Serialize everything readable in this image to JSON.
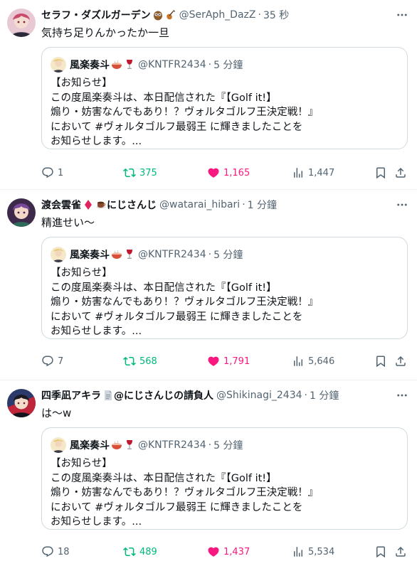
{
  "tweets": [
    {
      "name": "セラフ・ダズルガーデン",
      "handle": "@SerAph_DazZ",
      "time": "35 秒",
      "text": "気持ち足りんかったか一旦",
      "quote": {
        "name": "風楽奏斗",
        "handle": "@KNTFR2434",
        "time": "5 分鐘",
        "lines": [
          "【お知らせ】",
          "この度風楽奏斗は、本日配信された『【Golf it!】",
          "煽り・妨害なんでもあり！？ヴォルタゴルフ王決定戦！』",
          "において #ヴォルタゴルフ最弱王 に輝きましたことを",
          "お知らせします。..."
        ]
      },
      "stats": {
        "replies": "1",
        "retweets": "375",
        "likes": "1,165",
        "views": "1,447"
      }
    },
    {
      "name": "渡会雲雀",
      "suffix": "にじさんじ",
      "handle": "@watarai_hibari",
      "time": "1 分鐘",
      "text": "精進せい〜",
      "quote": {
        "name": "風楽奏斗",
        "handle": "@KNTFR2434",
        "time": "5 分鐘",
        "lines": [
          "【お知らせ】",
          "この度風楽奏斗は、本日配信された『【Golf it!】",
          "煽り・妨害なんでもあり！？ヴォルタゴルフ王決定戦！』",
          "において #ヴォルタゴルフ最弱王 に輝きましたことを",
          "お知らせします。..."
        ]
      },
      "stats": {
        "replies": "7",
        "retweets": "568",
        "likes": "1,791",
        "views": "5,646"
      }
    },
    {
      "name": "四季凪アキラ",
      "suffix": "@にじさんじの請負人",
      "handle": "@Shikinagi_2434",
      "time": "1 分鐘",
      "text": "は〜w",
      "quote": {
        "name": "風楽奏斗",
        "handle": "@KNTFR2434",
        "time": "5 分鐘",
        "lines": [
          "【お知らせ】",
          "この度風楽奏斗は、本日配信された『【Golf it!】",
          "煽り・妨害なんでもあり！？ヴォルタゴルフ王決定戦！』",
          "において #ヴォルタゴルフ最弱王 に輝きましたことを",
          "お知らせします。..."
        ]
      },
      "stats": {
        "replies": "18",
        "retweets": "489",
        "likes": "1,437",
        "views": "5,534"
      }
    }
  ],
  "icons": [
    "owl-icon",
    "violin-icon",
    "diamond-icon",
    "coffee-icon",
    "document-icon",
    "wine-glass-icon",
    "more-icon",
    "reply-icon",
    "retweet-icon",
    "like-icon",
    "views-icon",
    "bookmark-icon",
    "share-icon"
  ],
  "colors": {
    "retweet": "#00ba7c",
    "like": "#f91880",
    "secondary": "#536471",
    "border": "#cfd9de"
  }
}
